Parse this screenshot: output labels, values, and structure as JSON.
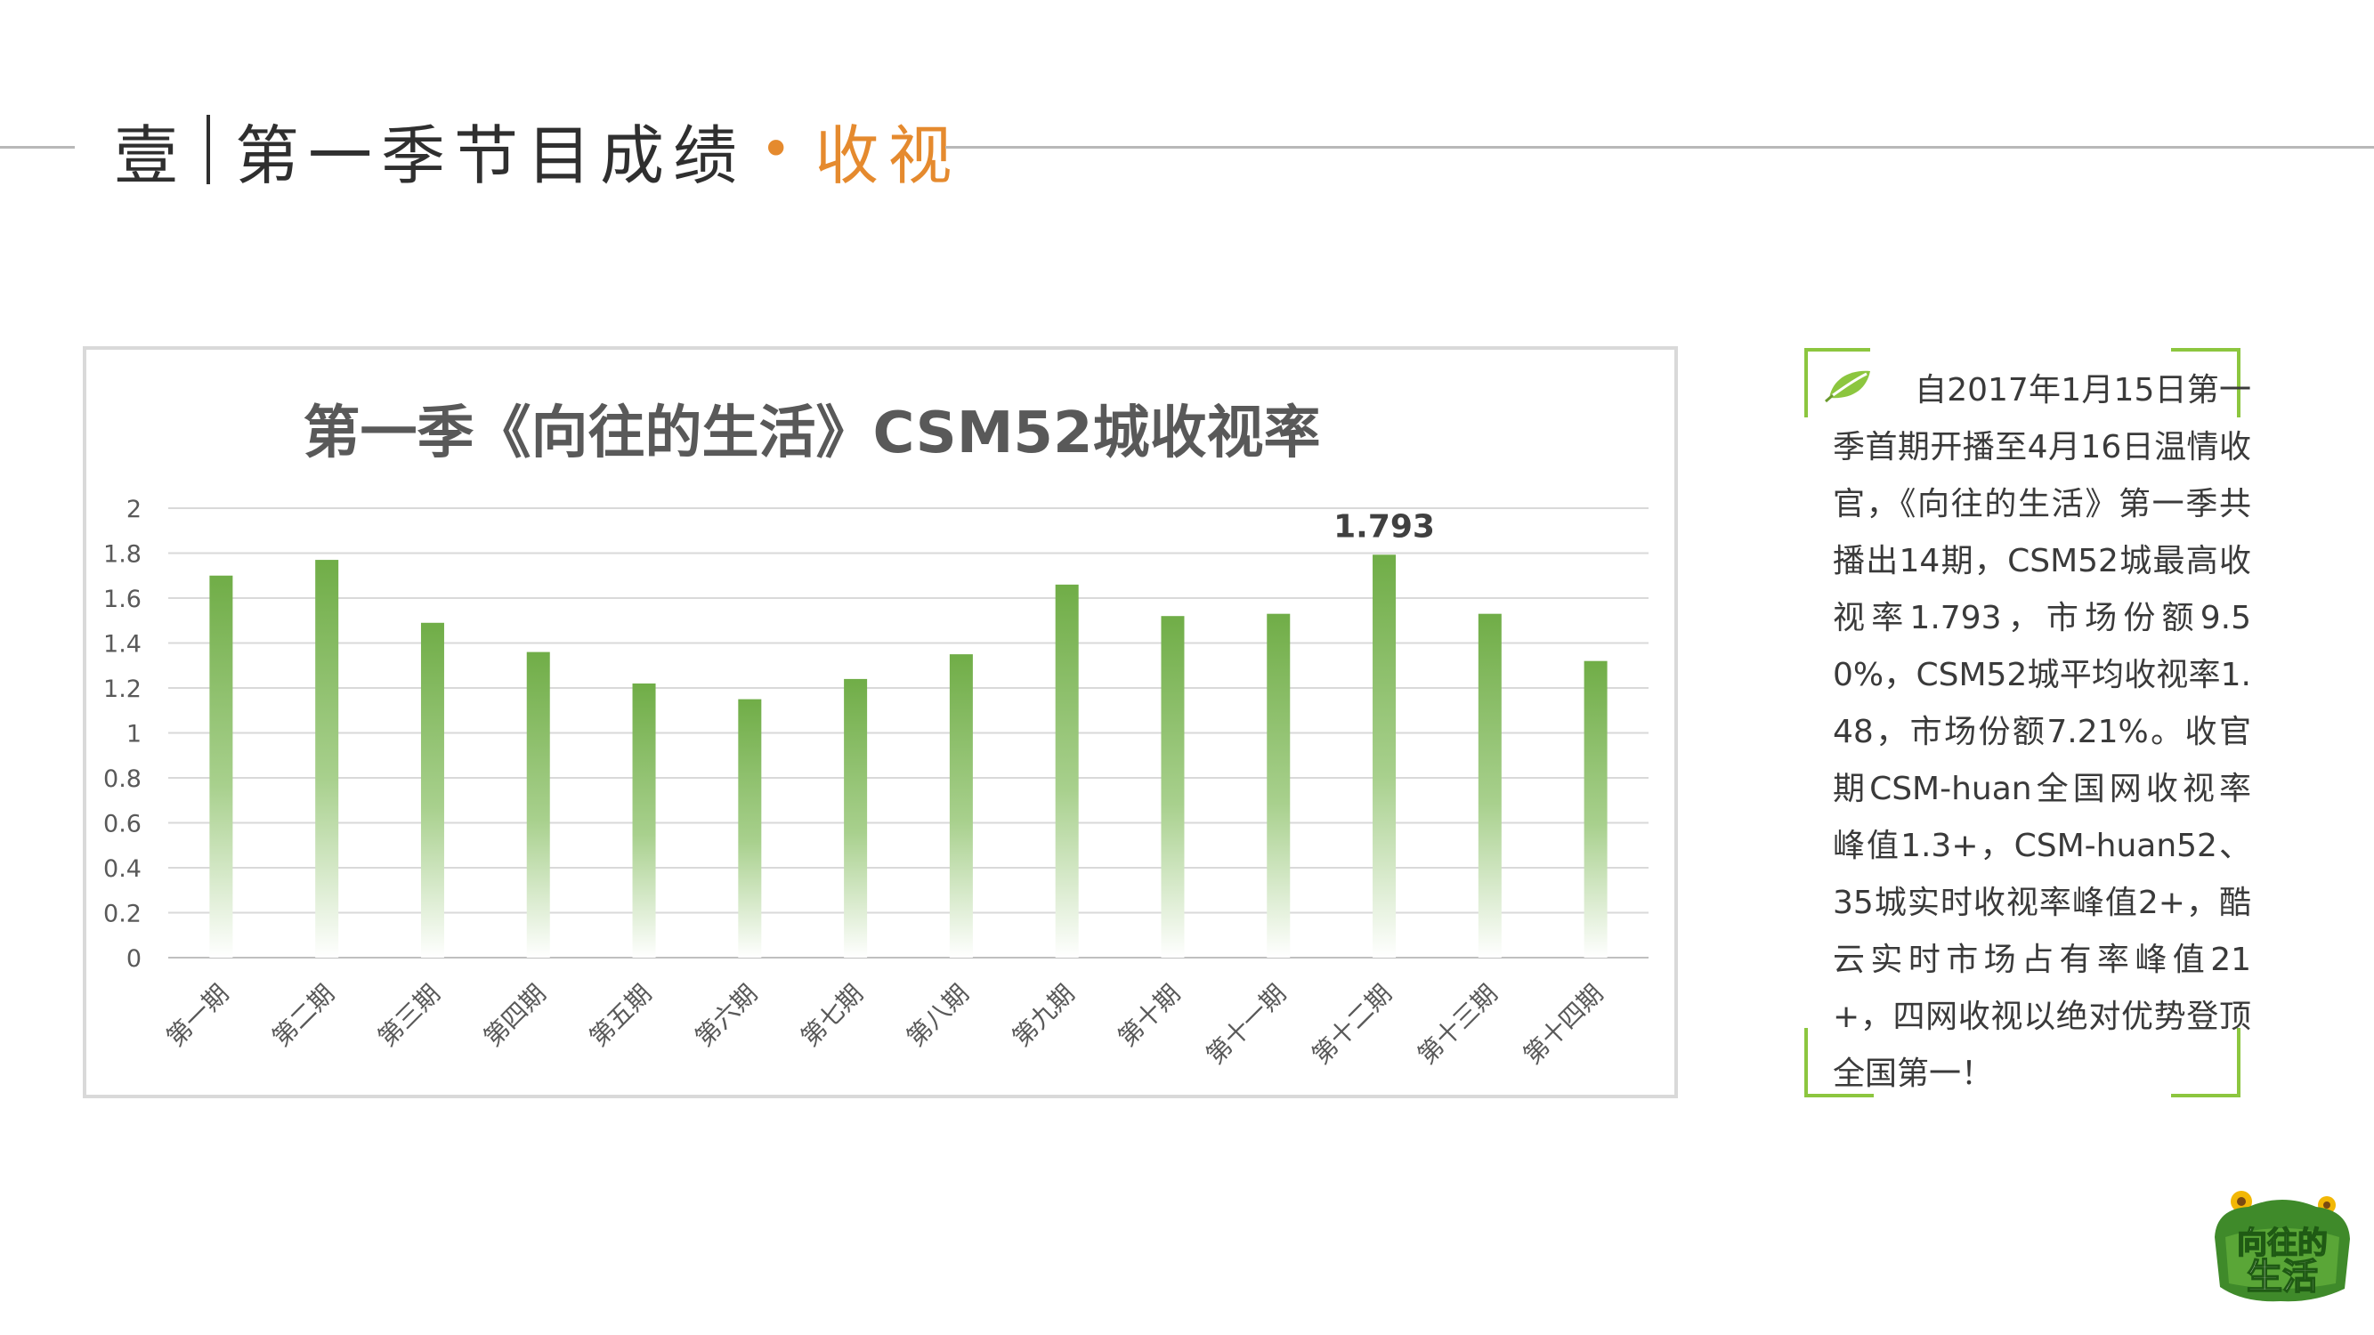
{
  "header": {
    "number": "壹",
    "title": "第一季节目成绩",
    "dot": "•",
    "accent": "收视"
  },
  "chart_data": {
    "type": "bar",
    "title": "第一季《向往的生活》CSM52城收视率",
    "categories": [
      "第一期",
      "第二期",
      "第三期",
      "第四期",
      "第五期",
      "第六期",
      "第七期",
      "第八期",
      "第九期",
      "第十期",
      "第十一期",
      "第十二期",
      "第十三期",
      "第十四期"
    ],
    "values": [
      1.7,
      1.77,
      1.49,
      1.36,
      1.22,
      1.15,
      1.24,
      1.35,
      1.66,
      1.52,
      1.53,
      1.793,
      1.53,
      1.32
    ],
    "ylim": [
      0,
      2
    ],
    "yticks": [
      "0",
      "0.2",
      "0.4",
      "0.6",
      "0.8",
      "1",
      "1.2",
      "1.4",
      "1.6",
      "1.8",
      "2"
    ],
    "data_labels": [
      {
        "index": 11,
        "text": "1.793"
      }
    ],
    "grid": true,
    "bar_color_top": "#70ad47",
    "bar_color_bottom": "#ffffff",
    "xlabel": "",
    "ylabel": ""
  },
  "description": "自2017年1月15日第一季首期开播至4月16日温情收官，《向往的生活》第一季共播出14期，CSM52城最高收视率1.793，市场份额9.50%，CSM52城平均收视率1.48，市场份额7.21%。收官期CSM-huan全国网收视率峰值1.3+，CSM-huan52、35城实时收视率峰值2+，酷云实时市场占有率峰值21+，四网收视以绝对优势登顶全国第一！",
  "colors": {
    "accent": "#e58a2e",
    "frame": "#8cc63f",
    "bar": "#70ad47"
  },
  "logo": {
    "text_top": "向往的",
    "text_bottom": "生活"
  }
}
